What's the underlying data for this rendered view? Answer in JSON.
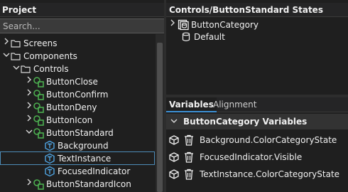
{
  "project_panel": {
    "title": "Project",
    "search_placeholder": "Search...",
    "tree": [
      {
        "label": "Screens",
        "expanded": false,
        "icon": "folder-icon"
      },
      {
        "label": "Components",
        "expanded": true,
        "icon": "folder-icon"
      },
      {
        "label": "Controls",
        "expanded": true,
        "icon": "folder-icon"
      },
      {
        "label": "ButtonClose",
        "expanded": false,
        "icon": "component-icon"
      },
      {
        "label": "ButtonConfirm",
        "expanded": false,
        "icon": "component-icon"
      },
      {
        "label": "ButtonDeny",
        "expanded": false,
        "icon": "component-icon"
      },
      {
        "label": "ButtonIcon",
        "expanded": false,
        "icon": "component-icon"
      },
      {
        "label": "ButtonStandard",
        "expanded": true,
        "icon": "component-icon"
      },
      {
        "label": "Background",
        "icon": "instance-icon"
      },
      {
        "label": "TextInstance",
        "icon": "instance-icon",
        "selected": true
      },
      {
        "label": "FocusedIndicator",
        "icon": "instance-icon"
      },
      {
        "label": "ButtonStandardIcon",
        "expanded": false,
        "icon": "component-icon"
      }
    ]
  },
  "states_panel": {
    "title": "Controls/ButtonStandard States",
    "items": [
      {
        "label": "ButtonCategory",
        "icon": "category-icon"
      },
      {
        "label": "Default",
        "icon": "state-icon"
      }
    ]
  },
  "variables_panel": {
    "tabs": [
      {
        "label": "Variables",
        "active": true
      },
      {
        "label": "Alignment",
        "active": false
      }
    ],
    "category_title": "ButtonCategory Variables",
    "variables": [
      {
        "name": "Background.ColorCategoryState"
      },
      {
        "name": "FocusedIndicator.Visible"
      },
      {
        "name": "TextInstance.ColorCategoryState"
      }
    ]
  },
  "colors": {
    "accent": "#3c8fd4",
    "component_green": "#4caf50",
    "instance_blue": "#4fa3e0",
    "folder_outline": "#d8d8d8"
  }
}
